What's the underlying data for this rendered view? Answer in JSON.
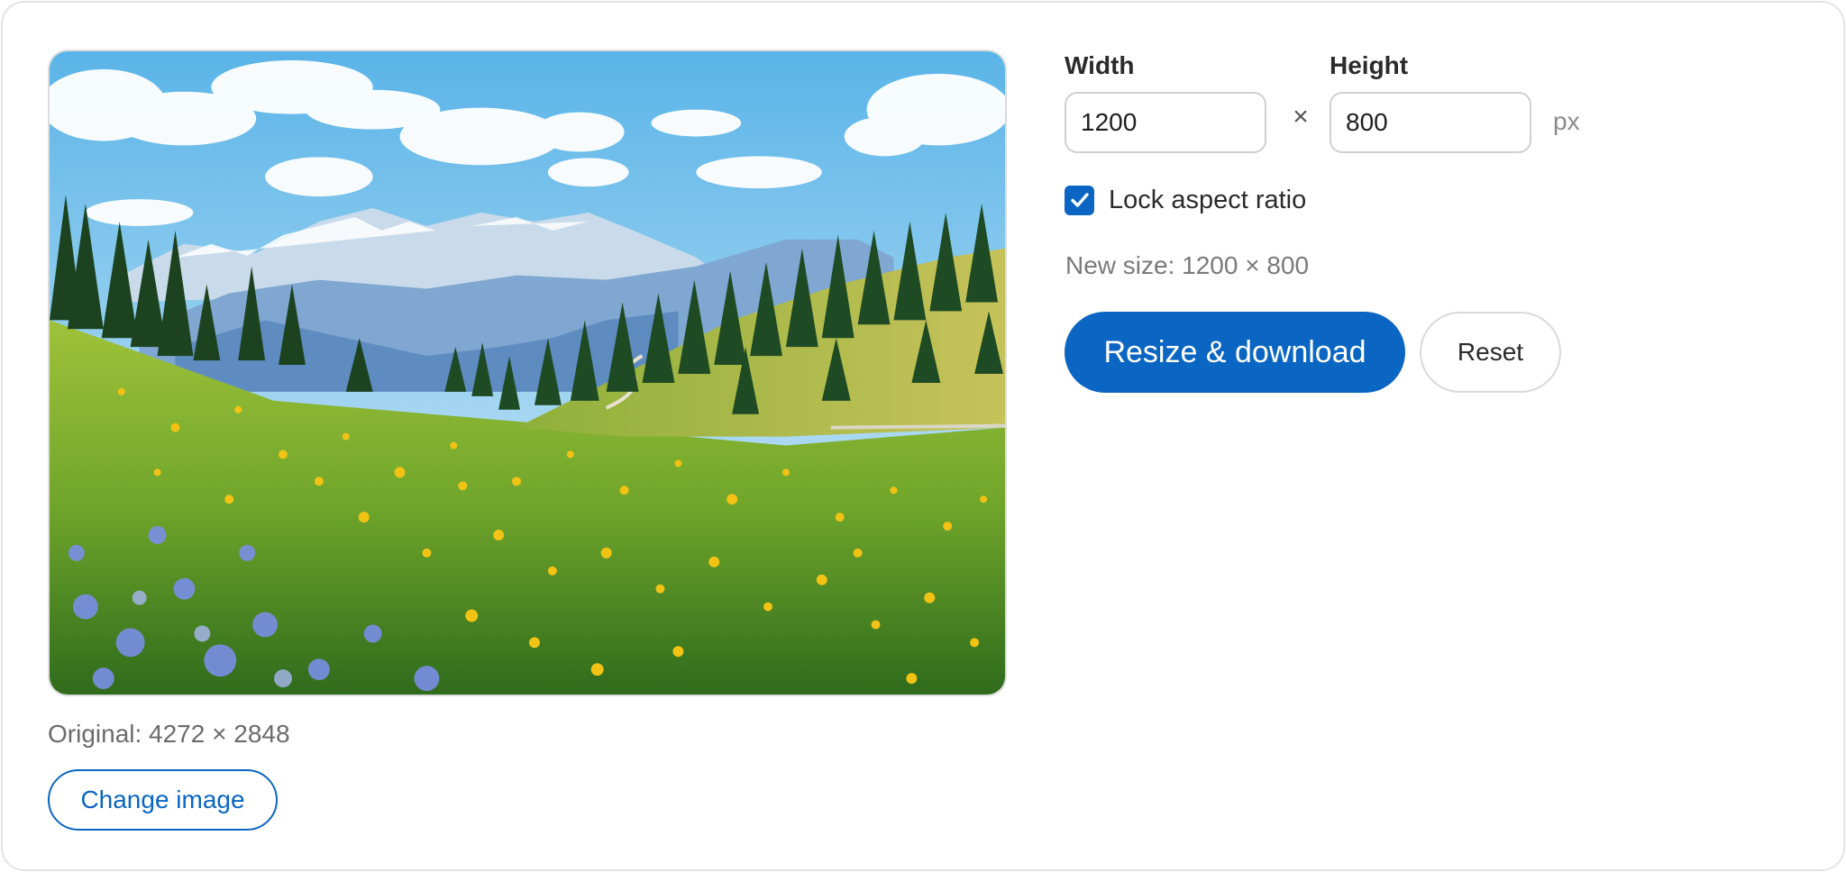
{
  "preview": {
    "image_alt": "Alpine meadow with wildflowers, pine trees and snowy mountains"
  },
  "original_size_text": "Original: 4272 × 2848",
  "change_image_label": "Change image",
  "width": {
    "label": "Width",
    "value": "1200"
  },
  "height": {
    "label": "Height",
    "value": "800"
  },
  "times_symbol": "×",
  "unit": "px",
  "lock_aspect": {
    "label": "Lock aspect ratio",
    "checked": true
  },
  "new_size_text": "New size: 1200 × 800",
  "resize_button_label": "Resize & download",
  "reset_button_label": "Reset",
  "colors": {
    "accent": "#0a66c2",
    "muted_text": "#6b6b6b",
    "border": "#d0d0d0"
  },
  "icons": {
    "checkbox": "checkmark-icon"
  }
}
